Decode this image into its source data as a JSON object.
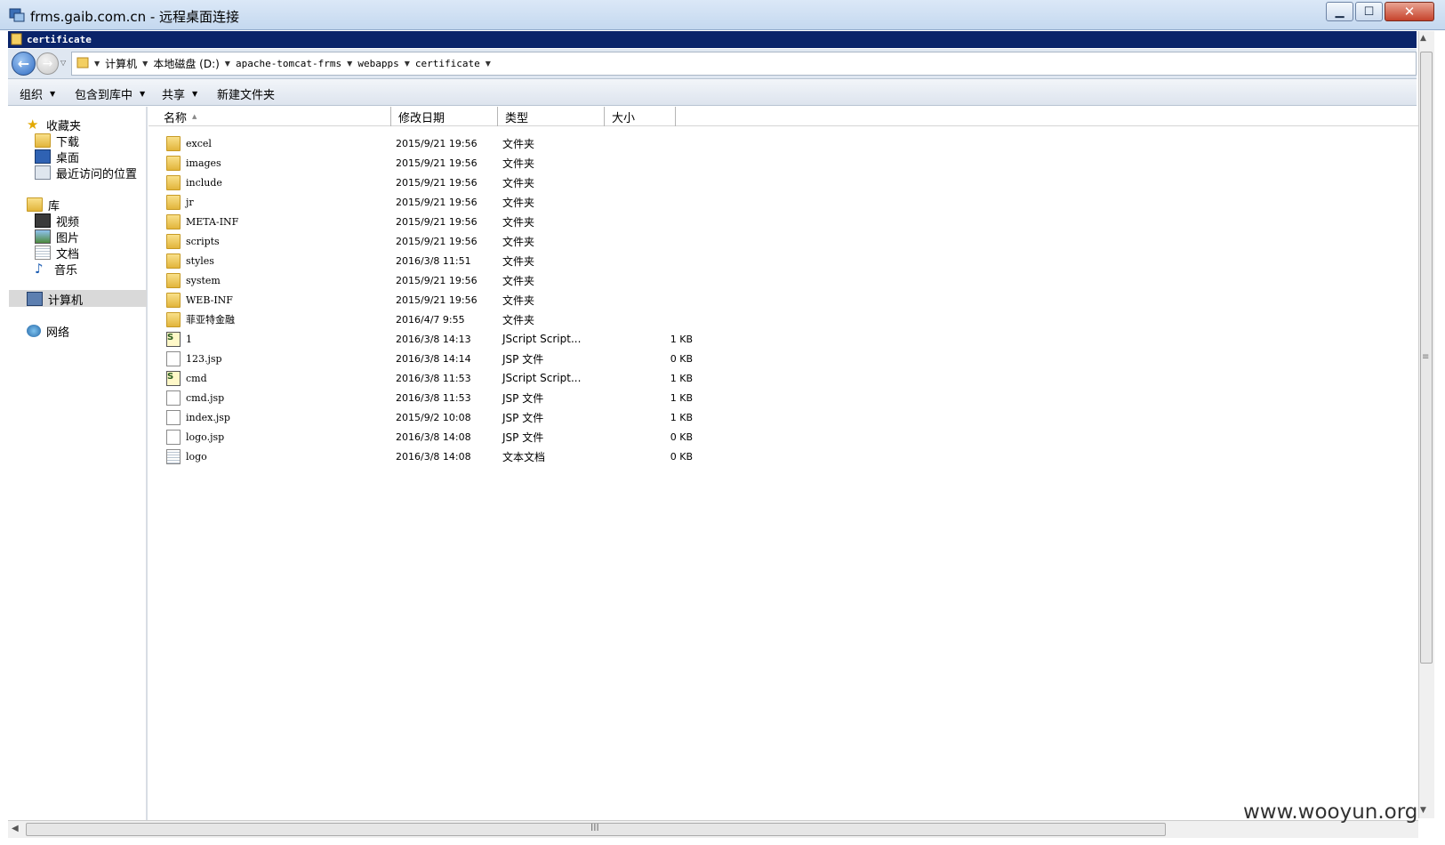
{
  "window": {
    "title": "frms.gaib.com.cn - 远程桌面连接",
    "minimize_glyph": "▁",
    "maximize_glyph": "☐",
    "close_glyph": "✕"
  },
  "explorer": {
    "title": "certificate"
  },
  "nav_buttons": {
    "back_glyph": "←",
    "forward_glyph": "→",
    "history_glyph": "▽"
  },
  "breadcrumb": [
    "计算机",
    "本地磁盘 (D:)",
    "apache-tomcat-frms",
    "webapps",
    "certificate"
  ],
  "toolbar": {
    "organize": "组织",
    "include_in_library": "包含到库中",
    "share": "共享",
    "new_folder": "新建文件夹",
    "dropdown_glyph": "▼"
  },
  "nav_pane": {
    "favorites": "收藏夹",
    "downloads": "下载",
    "desktop": "桌面",
    "recent": "最近访问的位置",
    "libraries": "库",
    "videos": "视频",
    "pictures": "图片",
    "documents": "文档",
    "music": "音乐",
    "computer": "计算机",
    "network": "网络"
  },
  "columns": {
    "name": "名称",
    "date": "修改日期",
    "type": "类型",
    "size": "大小",
    "sort_glyph": "▲"
  },
  "files": [
    {
      "name": "excel",
      "date": "2015/9/21 19:56",
      "type": "文件夹",
      "size": "",
      "icon": "folder-icon"
    },
    {
      "name": "images",
      "date": "2015/9/21 19:56",
      "type": "文件夹",
      "size": "",
      "icon": "folder-icon"
    },
    {
      "name": "include",
      "date": "2015/9/21 19:56",
      "type": "文件夹",
      "size": "",
      "icon": "folder-icon"
    },
    {
      "name": "jr",
      "date": "2015/9/21 19:56",
      "type": "文件夹",
      "size": "",
      "icon": "folder-icon"
    },
    {
      "name": "META-INF",
      "date": "2015/9/21 19:56",
      "type": "文件夹",
      "size": "",
      "icon": "folder-icon"
    },
    {
      "name": "scripts",
      "date": "2015/9/21 19:56",
      "type": "文件夹",
      "size": "",
      "icon": "folder-icon"
    },
    {
      "name": "styles",
      "date": "2016/3/8 11:51",
      "type": "文件夹",
      "size": "",
      "icon": "folder-icon"
    },
    {
      "name": "system",
      "date": "2015/9/21 19:56",
      "type": "文件夹",
      "size": "",
      "icon": "folder-icon"
    },
    {
      "name": "WEB-INF",
      "date": "2015/9/21 19:56",
      "type": "文件夹",
      "size": "",
      "icon": "folder-icon"
    },
    {
      "name": "菲亚特金融",
      "date": "2016/4/7 9:55",
      "type": "文件夹",
      "size": "",
      "icon": "folder-icon"
    },
    {
      "name": "1",
      "date": "2016/3/8 14:13",
      "type": "JScript Script...",
      "size": "1 KB",
      "icon": "script-icon"
    },
    {
      "name": "123.jsp",
      "date": "2016/3/8 14:14",
      "type": "JSP 文件",
      "size": "0 KB",
      "icon": "file-icon"
    },
    {
      "name": "cmd",
      "date": "2016/3/8 11:53",
      "type": "JScript Script...",
      "size": "1 KB",
      "icon": "script-icon"
    },
    {
      "name": "cmd.jsp",
      "date": "2016/3/8 11:53",
      "type": "JSP 文件",
      "size": "1 KB",
      "icon": "file-icon"
    },
    {
      "name": "index.jsp",
      "date": "2015/9/2 10:08",
      "type": "JSP 文件",
      "size": "1 KB",
      "icon": "file-icon"
    },
    {
      "name": "logo.jsp",
      "date": "2016/3/8 14:08",
      "type": "JSP 文件",
      "size": "0 KB",
      "icon": "file-icon"
    },
    {
      "name": "logo",
      "date": "2016/3/8 14:08",
      "type": "文本文档",
      "size": "0 KB",
      "icon": "text-file-icon"
    }
  ],
  "scrollbars": {
    "up_glyph": "▲",
    "down_glyph": "▼",
    "left_glyph": "◀",
    "grip_v": "≡",
    "grip_h": "III"
  },
  "watermark": "www.wooyun.org"
}
